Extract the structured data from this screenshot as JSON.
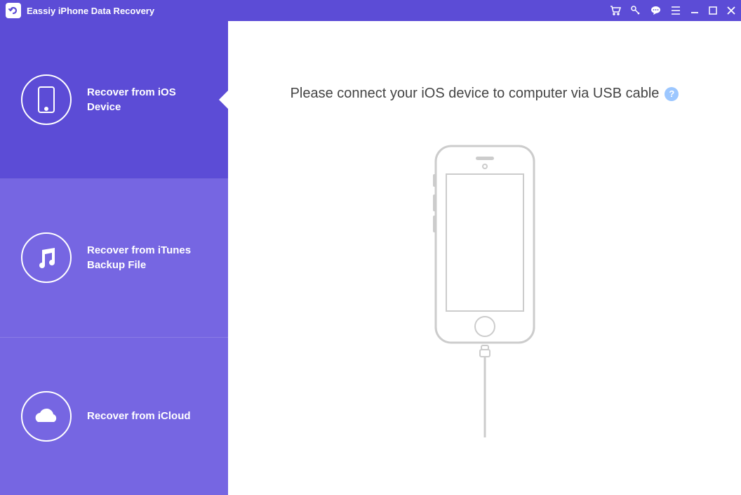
{
  "app": {
    "title": "Eassiy iPhone Data Recovery"
  },
  "sidebar": {
    "items": [
      {
        "label": "Recover from iOS Device",
        "icon": "phone-icon",
        "active": true
      },
      {
        "label": "Recover from iTunes Backup File",
        "icon": "music-icon",
        "active": false
      },
      {
        "label": "Recover from iCloud",
        "icon": "cloud-icon",
        "active": false
      }
    ]
  },
  "main": {
    "prompt": "Please connect your iOS device to computer via USB cable",
    "help": "?"
  }
}
